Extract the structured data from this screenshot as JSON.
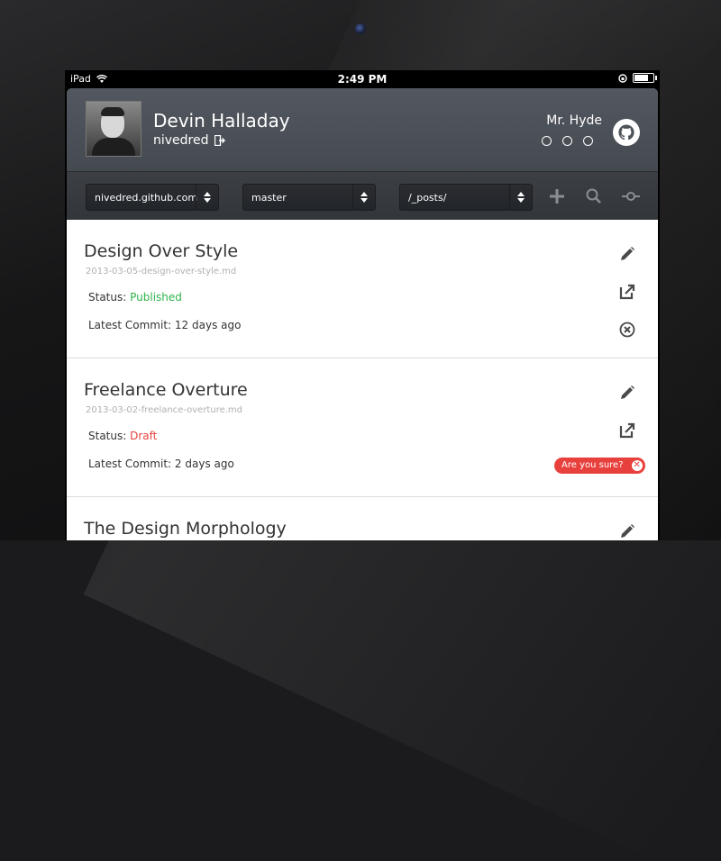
{
  "statusbar": {
    "carrier": "iPad",
    "time": "2:49 PM"
  },
  "profile": {
    "name": "Devin Halladay",
    "handle": "nivedred",
    "repo_owner": "Mr. Hyde"
  },
  "toolbar": {
    "repo": "nivedred.github.com",
    "branch": "master",
    "path": "/_posts/"
  },
  "posts": [
    {
      "title": "Design Over Style",
      "file": "2013-03-05-design-over-style.md",
      "status_label": "Status:",
      "status": "Published",
      "commit_label": "Latest Commit:",
      "commit": "12 days ago"
    },
    {
      "title": "Freelance Overture",
      "file": "2013-03-02-freelance-overture.md",
      "status_label": "Status:",
      "status": "Draft",
      "commit_label": "Latest Commit:",
      "commit": "2 days ago",
      "confirm": "Are you sure?"
    },
    {
      "title": "The Design Morphology"
    }
  ],
  "colors": {
    "published": "#2fb34a",
    "draft": "#e8413d",
    "header": "#4e535a"
  }
}
